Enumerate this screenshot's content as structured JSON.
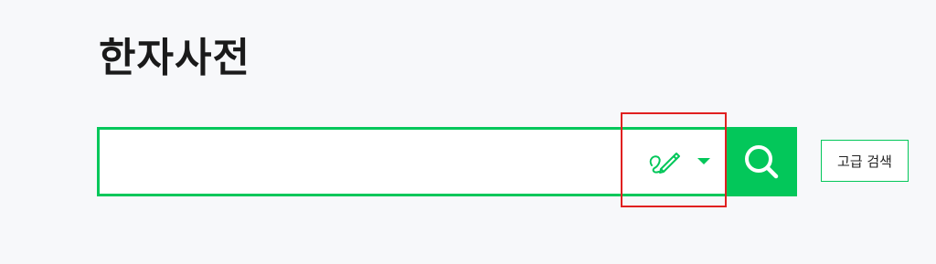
{
  "page": {
    "title": "한자사전"
  },
  "search": {
    "value": "",
    "placeholder": "",
    "handwriting_icon": "handwriting-pen-icon",
    "dropdown_icon": "caret-down-icon",
    "submit_icon": "search-icon"
  },
  "advanced_search": {
    "label": "고급 검색"
  },
  "colors": {
    "accent": "#03c75a",
    "highlight_box": "#e02020",
    "background": "#f7f8fa",
    "title_text": "#1a1a1a"
  }
}
